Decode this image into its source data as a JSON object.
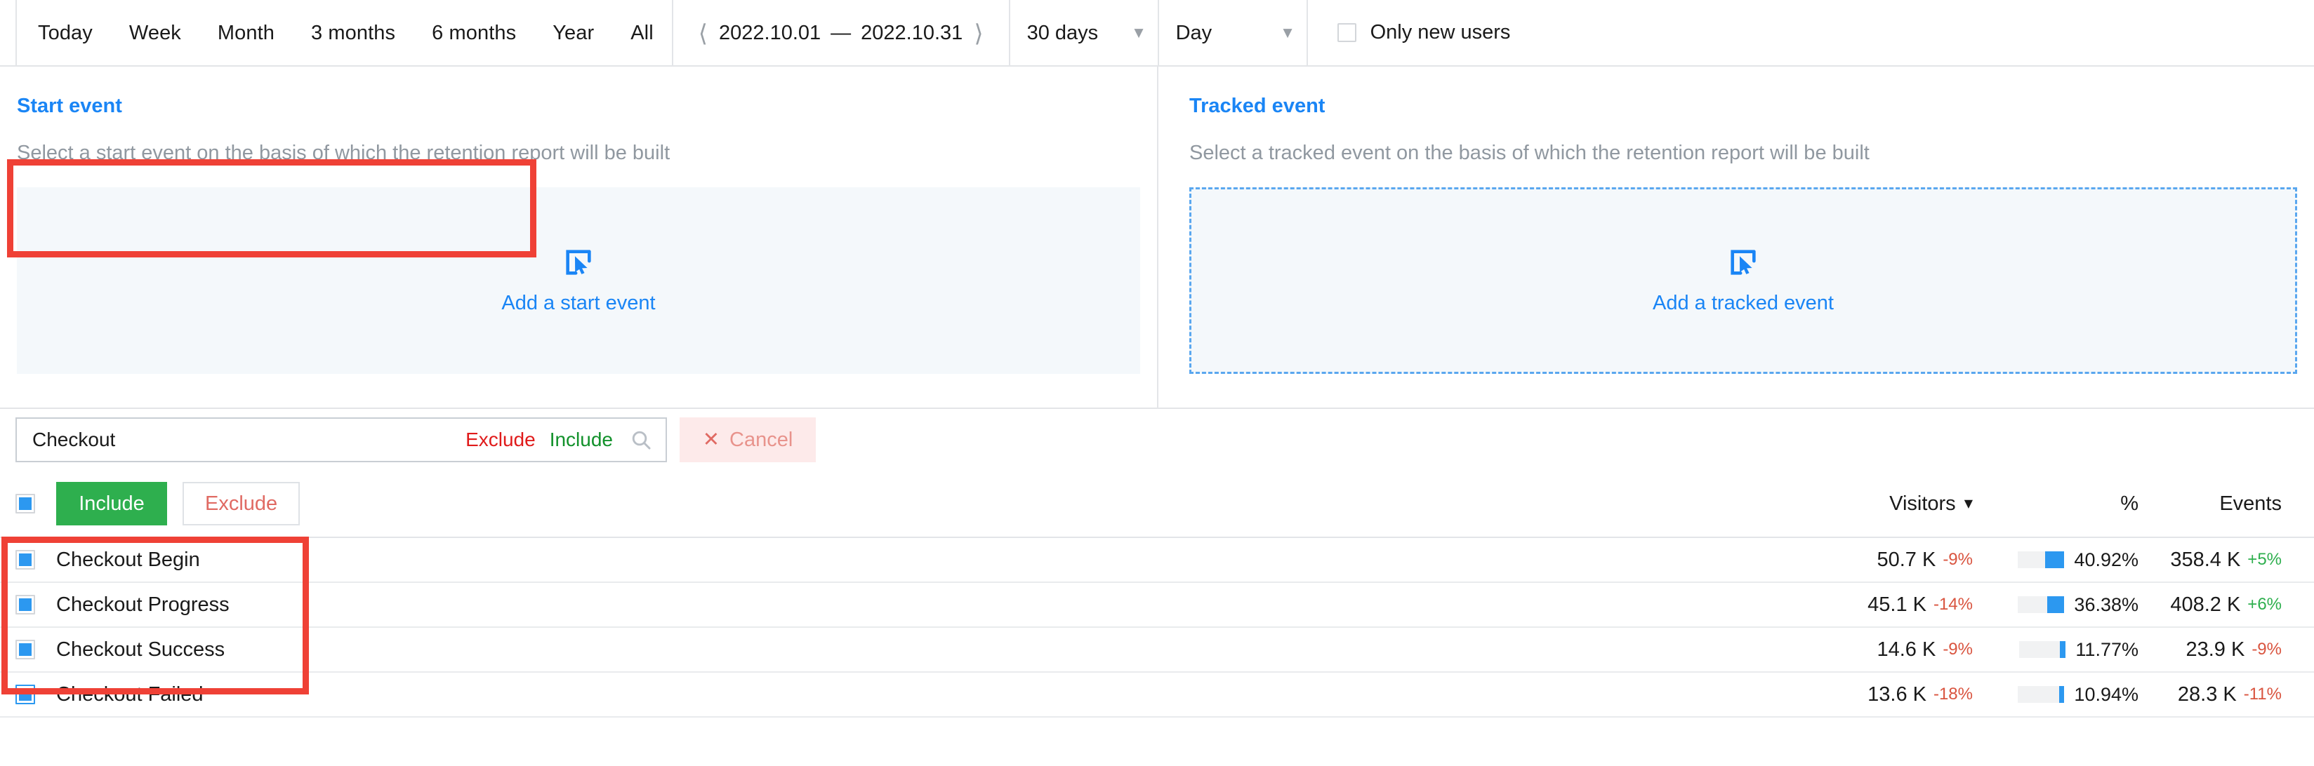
{
  "toolbar": {
    "ranges": [
      "Today",
      "Week",
      "Month",
      "3 months",
      "6 months",
      "Year",
      "All"
    ],
    "date_prev_icon": "chevron-left-icon",
    "date_next_icon": "chevron-right-icon",
    "date_from": "2022.10.01",
    "date_dash": "—",
    "date_to": "2022.10.31",
    "granularity_value": "30 days",
    "group_value": "Day",
    "caret": "▼",
    "only_new_users_label": "Only new users",
    "only_new_users_checked": false
  },
  "start_panel": {
    "title": "Start event",
    "subtitle": "Select a start event on the basis of which the retention report will be built",
    "dropzone_label": "Add a start event",
    "dropzone_icon": "add-event-cursor-icon"
  },
  "tracked_panel": {
    "title": "Tracked event",
    "subtitle": "Select a tracked event on the basis of which the retention report will be built",
    "dropzone_label": "Add a tracked event",
    "dropzone_icon": "add-event-cursor-icon"
  },
  "search": {
    "value": "Checkout",
    "exclude_link": "Exclude",
    "include_link": "Include",
    "search_icon": "search-icon",
    "cancel_icon": "close-x-icon",
    "cancel_label": "Cancel"
  },
  "actions": {
    "include_label": "Include",
    "exclude_label": "Exclude",
    "select_all_checked": true
  },
  "columns": {
    "visitors": "Visitors",
    "sort_caret": "▼",
    "percent": "%",
    "events": "Events"
  },
  "table": {
    "rows": [
      {
        "name": "Checkout Begin",
        "checked": true,
        "focused": false,
        "visitors": "50.7 K",
        "visitors_delta": "-9%",
        "visitors_delta_sign": "neg",
        "percent": "40.92%",
        "percent_value": 40.92,
        "events": "358.4 K",
        "events_delta": "+5%",
        "events_delta_sign": "pos"
      },
      {
        "name": "Checkout Progress",
        "checked": true,
        "focused": false,
        "visitors": "45.1 K",
        "visitors_delta": "-14%",
        "visitors_delta_sign": "neg",
        "percent": "36.38%",
        "percent_value": 36.38,
        "events": "408.2 K",
        "events_delta": "+6%",
        "events_delta_sign": "pos"
      },
      {
        "name": "Checkout Success",
        "checked": true,
        "focused": false,
        "visitors": "14.6 K",
        "visitors_delta": "-9%",
        "visitors_delta_sign": "neg",
        "percent": "11.77%",
        "percent_value": 11.77,
        "events": "23.9 K",
        "events_delta": "-9%",
        "events_delta_sign": "neg"
      },
      {
        "name": "Checkout Failed",
        "checked": true,
        "focused": true,
        "visitors": "13.6 K",
        "visitors_delta": "-18%",
        "visitors_delta_sign": "neg",
        "percent": "10.94%",
        "percent_value": 10.94,
        "events": "28.3 K",
        "events_delta": "-11%",
        "events_delta_sign": "neg"
      }
    ]
  },
  "colors": {
    "accent_blue": "#1a85f5",
    "bar_blue": "#2c98f0",
    "include_green": "#2eaf4e",
    "exclude_red": "#e06a63",
    "annotation_red": "#ef4136",
    "negative": "#d9543f",
    "positive": "#2eaf4e"
  }
}
